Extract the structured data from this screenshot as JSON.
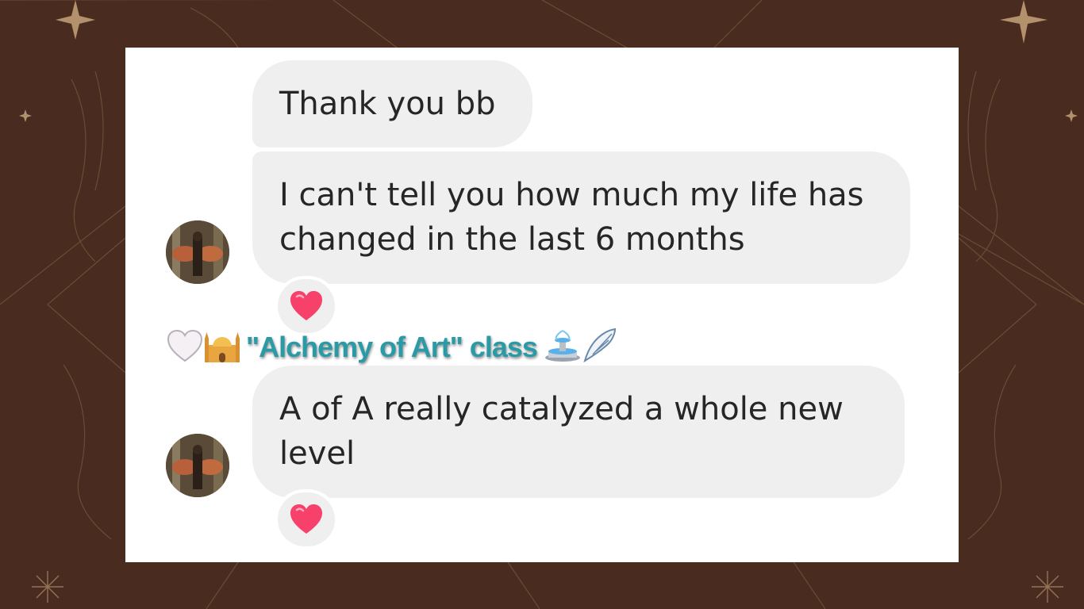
{
  "messages": [
    {
      "text": "Thank you bb"
    },
    {
      "text": "I can't tell you how much my life has changed in the last 6 months",
      "reaction": "red-heart"
    },
    {
      "text": "A of A really catalyzed a whole new level",
      "reaction": "red-heart"
    }
  ],
  "caption": {
    "text": "\"Alchemy of Art\" class",
    "leading_icons": [
      "white-heart-icon",
      "mosque-icon"
    ],
    "trailing_icons": [
      "fountain-icon",
      "wing-icon"
    ],
    "color": "#2a9aa6"
  },
  "colors": {
    "background": "#4a2b1f",
    "card": "#ffffff",
    "bubble": "#efefef",
    "text": "#262626",
    "heart": "#f7406a"
  }
}
